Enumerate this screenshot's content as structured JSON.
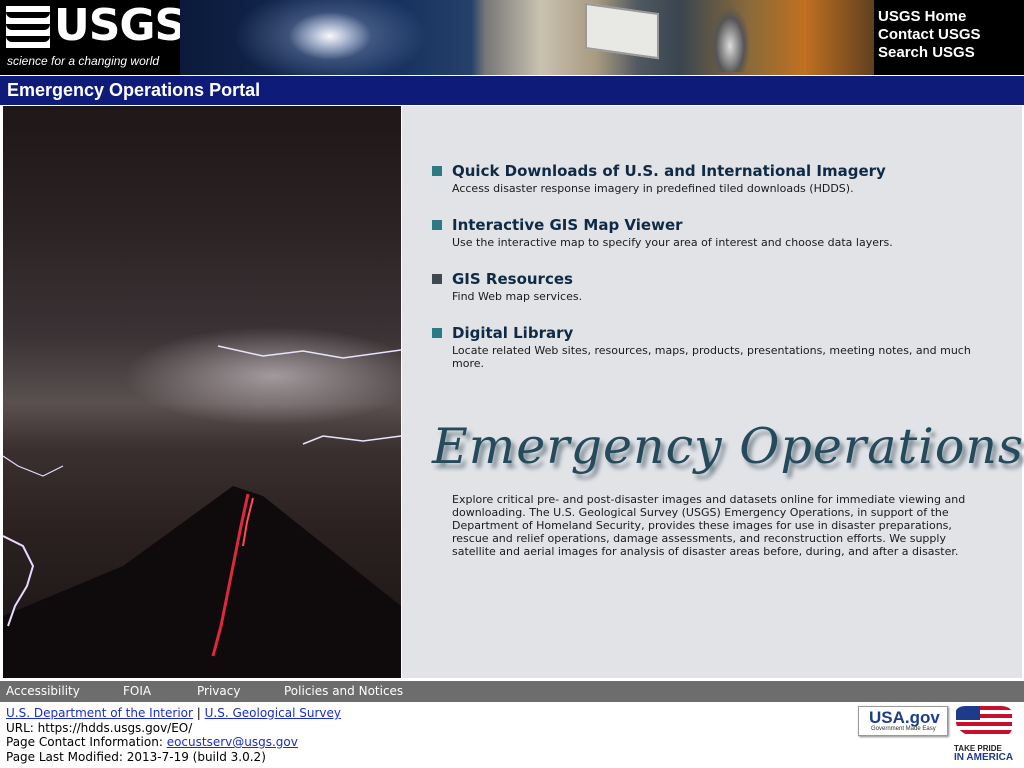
{
  "header": {
    "logo_word": "USGS",
    "logo_tagline": "science for a changing world",
    "links": [
      "USGS Home",
      "Contact USGS",
      "Search USGS"
    ]
  },
  "titlebar": {
    "title": "Emergency Operations Portal"
  },
  "main": {
    "items": [
      {
        "title": "Quick Downloads of U.S. and International Imagery",
        "desc": "Access disaster response imagery in predefined tiled downloads (HDDS)."
      },
      {
        "title": "Interactive GIS Map Viewer",
        "desc": "Use the interactive map to specify your area of interest and choose data layers."
      },
      {
        "title": "GIS Resources",
        "desc": "Find Web map services."
      },
      {
        "title": "Digital Library",
        "desc": "Locate related Web sites, resources, maps, products, presentations, meeting notes, and much more."
      }
    ],
    "heading": "Emergency Operations",
    "intro": "Explore critical pre- and post-disaster images and datasets online for immediate viewing and downloading. The U.S. Geological Survey (USGS) Emergency Operations, in support of the Department of Homeland Security, provides these images for use in disaster preparations, rescue and relief operations, damage assessments, and reconstruction efforts. We supply satellite and aerial images for analysis of disaster areas before, during, and after a disaster."
  },
  "footer": {
    "nav": [
      "Accessibility",
      "FOIA",
      "Privacy",
      "Policies and Notices"
    ],
    "doi_link": "U.S. Department of the Interior",
    "separator": "|",
    "usgs_link": "U.S. Geological Survey",
    "url_line": "URL: https://hdds.usgs.gov/EO/",
    "contact_label": "Page Contact Information:",
    "contact_email": "eocustserv@usgs.gov",
    "modified_line": "Page Last Modified: 2013-7-19 (build 3.0.2)",
    "usagov_text": "USA.gov",
    "usagov_sub": "Government Made Easy",
    "pride_line1": "TAKE PRIDE",
    "pride_line2": "IN AMERICA"
  }
}
